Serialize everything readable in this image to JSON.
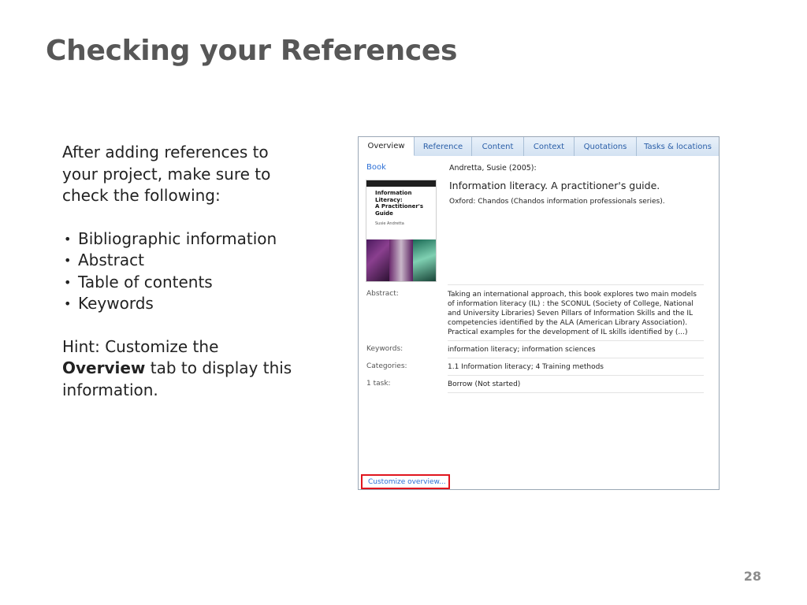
{
  "slide": {
    "title": "Checking your References",
    "intro": "After adding references to your project, make sure to check the following:",
    "bullets": [
      "Bibliographic information",
      "Abstract",
      "Table of contents",
      "Keywords"
    ],
    "hint_prefix": "Hint: Customize the",
    "hint_bold": "Overview",
    "hint_suffix": "tab to display this information.",
    "page_number": "28"
  },
  "panel": {
    "tabs": [
      {
        "label": "Overview",
        "active": true
      },
      {
        "label": "Reference"
      },
      {
        "label": "Content"
      },
      {
        "label": "Context"
      },
      {
        "label": "Quotations"
      },
      {
        "label": "Tasks & locations"
      }
    ],
    "type_label": "Book",
    "cover": {
      "title_lines": [
        "Information",
        "Literacy:",
        "A Practitioner's",
        "Guide"
      ],
      "author": "Susie Andretta"
    },
    "reference": {
      "author_line": "Andretta, Susie (2005):",
      "title": "Information literacy. A practitioner's guide.",
      "publisher_line": "Oxford: Chandos (Chandos information professionals series)."
    },
    "fields": {
      "abstract_label": "Abstract:",
      "abstract_value": "Taking an international approach, this book explores two main models of information literacy (IL) : the SCONUL (Society of College, National and University Libraries) Seven Pillars of Information Skills and the IL competencies identified by the ALA (American Library Association). Practical examples for the development of IL skills identified by  (...)",
      "keywords_label": "Keywords:",
      "keywords_value": "information literacy; information sciences",
      "categories_label": "Categories:",
      "categories_value": "1.1 Information literacy; 4 Training methods",
      "tasks_label": "1 task:",
      "tasks_value": "Borrow (Not started)"
    },
    "customize_link": "Customize overview...",
    "colors": {
      "highlight_border": "#e0161e",
      "link": "#2b6fd6",
      "tab_text": "#2b5fa8"
    }
  }
}
